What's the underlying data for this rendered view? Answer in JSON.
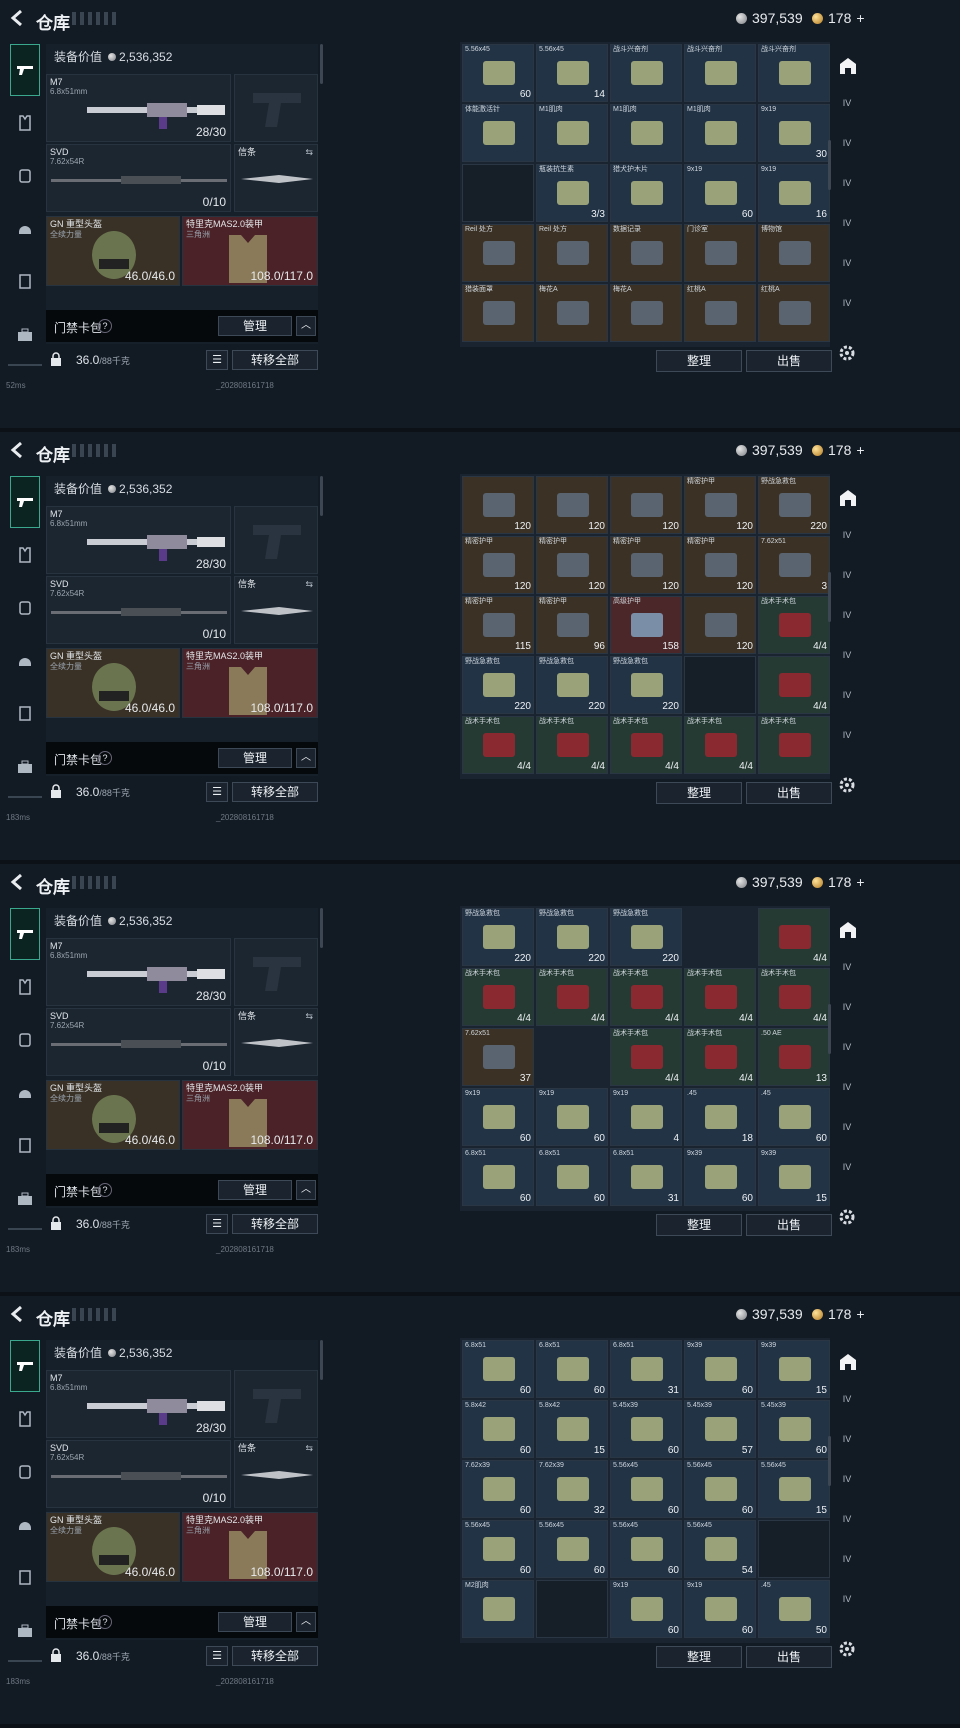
{
  "header": {
    "title": "仓库",
    "silver_amount": "397,539",
    "gold_amount": "178",
    "gold_plus": "+"
  },
  "loadout": {
    "equip_value_label": "装备价值",
    "equip_value": "2,536,352",
    "primary": {
      "name": "M7",
      "caliber": "6.8x51mm",
      "ammo": "28/30"
    },
    "secondary": {
      "name": "SVD",
      "caliber": "7.62x54R",
      "ammo": "0/10"
    },
    "melee": {
      "name": "信条"
    },
    "helmet": {
      "name": "GN 重型头盔",
      "sub": "全续力量",
      "durability": "46.0/46.0"
    },
    "armor": {
      "name": "特里克MAS2.0装甲",
      "sub": "三角洲",
      "durability": "108.0/117.0"
    },
    "keycard_label": "门禁卡包",
    "keycard_help": "?",
    "manage_label": "管理",
    "weight": "36.0",
    "weight_max": "/88千克",
    "transfer_all_label": "转移全部"
  },
  "stash_actions": {
    "sort_label": "整理",
    "sell_label": "出售"
  },
  "status": {
    "ping_1": "183ms",
    "ping_4": "52ms",
    "build": "_202808161718"
  },
  "panels": [
    {
      "cells": [
        {
          "c": 0,
          "r": 0,
          "t": "brown",
          "l": "",
          "n": "120"
        },
        {
          "c": 1,
          "r": 0,
          "t": "brown",
          "l": "",
          "n": "120"
        },
        {
          "c": 2,
          "r": 0,
          "t": "brown",
          "l": "",
          "n": "120"
        },
        {
          "c": 3,
          "r": 0,
          "t": "brown",
          "l": "精密护甲",
          "n": "120"
        },
        {
          "c": 4,
          "r": 0,
          "t": "brown",
          "l": "野战急救包",
          "n": "220"
        },
        {
          "c": 0,
          "r": 1,
          "t": "brown",
          "l": "精密护甲",
          "n": "120"
        },
        {
          "c": 1,
          "r": 1,
          "t": "brown",
          "l": "精密护甲",
          "n": "120"
        },
        {
          "c": 2,
          "r": 1,
          "t": "brown",
          "l": "精密护甲",
          "n": "120"
        },
        {
          "c": 3,
          "r": 1,
          "t": "brown",
          "l": "精密护甲",
          "n": "120"
        },
        {
          "c": 4,
          "r": 1,
          "t": "brown",
          "l": "7.62x51",
          "n": "3"
        },
        {
          "c": 0,
          "r": 2,
          "t": "brown",
          "l": "精密护甲",
          "n": "115"
        },
        {
          "c": 1,
          "r": 2,
          "t": "brown",
          "l": "精密护甲",
          "n": "96"
        },
        {
          "c": 2,
          "r": 2,
          "t": "red",
          "l": "高级护甲",
          "n": "158"
        },
        {
          "c": 3,
          "r": 2,
          "t": "brown",
          "l": "",
          "n": "120"
        },
        {
          "c": 4,
          "r": 2,
          "t": "green",
          "l": "战术手术包",
          "n": "4/4"
        },
        {
          "c": 0,
          "r": 3,
          "t": "blue",
          "l": "野战急救包",
          "n": "220"
        },
        {
          "c": 1,
          "r": 3,
          "t": "blue",
          "l": "野战急救包",
          "n": "220"
        },
        {
          "c": 2,
          "r": 3,
          "t": "blue",
          "l": "野战急救包",
          "n": "220"
        },
        {
          "c": 3,
          "r": 3,
          "t": "empty",
          "l": "",
          "n": ""
        },
        {
          "c": 4,
          "r": 3,
          "t": "green",
          "l": "",
          "n": "4/4"
        },
        {
          "c": 0,
          "r": 4,
          "t": "green",
          "l": "战术手术包",
          "n": "4/4"
        },
        {
          "c": 1,
          "r": 4,
          "t": "green",
          "l": "战术手术包",
          "n": "4/4"
        },
        {
          "c": 2,
          "r": 4,
          "t": "green",
          "l": "战术手术包",
          "n": "4/4"
        },
        {
          "c": 3,
          "r": 4,
          "t": "green",
          "l": "战术手术包",
          "n": "4/4"
        },
        {
          "c": 4,
          "r": 4,
          "t": "green",
          "l": "战术手术包",
          "n": ""
        }
      ]
    },
    {
      "cells": [
        {
          "c": 0,
          "r": 0,
          "t": "blue",
          "l": "野战急救包",
          "n": "220"
        },
        {
          "c": 1,
          "r": 0,
          "t": "blue",
          "l": "野战急救包",
          "n": "220"
        },
        {
          "c": 2,
          "r": 0,
          "t": "blue",
          "l": "野战急救包",
          "n": "220"
        },
        {
          "c": 4,
          "r": 0,
          "t": "green",
          "l": "",
          "n": "4/4"
        },
        {
          "c": 0,
          "r": 1,
          "t": "green",
          "l": "战术手术包",
          "n": "4/4"
        },
        {
          "c": 1,
          "r": 1,
          "t": "green",
          "l": "战术手术包",
          "n": "4/4"
        },
        {
          "c": 2,
          "r": 1,
          "t": "green",
          "l": "战术手术包",
          "n": "4/4"
        },
        {
          "c": 3,
          "r": 1,
          "t": "green",
          "l": "战术手术包",
          "n": "4/4"
        },
        {
          "c": 4,
          "r": 1,
          "t": "green",
          "l": "战术手术包",
          "n": "4/4"
        },
        {
          "c": 0,
          "r": 2,
          "t": "brown",
          "l": "7.62x51",
          "n": "37"
        },
        {
          "c": 2,
          "r": 2,
          "t": "green",
          "l": "战术手术包",
          "n": "4/4"
        },
        {
          "c": 3,
          "r": 2,
          "t": "green",
          "l": "战术手术包",
          "n": "4/4"
        },
        {
          "c": 4,
          "r": 2,
          "t": "green",
          "l": ".50 AE",
          "n": "13"
        },
        {
          "c": 0,
          "r": 3,
          "t": "blue",
          "l": "9x19",
          "n": "60"
        },
        {
          "c": 1,
          "r": 3,
          "t": "blue",
          "l": "9x19",
          "n": "60"
        },
        {
          "c": 2,
          "r": 3,
          "t": "blue",
          "l": "9x19",
          "n": "4"
        },
        {
          "c": 3,
          "r": 3,
          "t": "blue",
          "l": ".45",
          "n": "18"
        },
        {
          "c": 4,
          "r": 3,
          "t": "blue",
          "l": ".45",
          "n": "60"
        },
        {
          "c": 0,
          "r": 4,
          "t": "blue",
          "l": "6.8x51",
          "n": "60"
        },
        {
          "c": 1,
          "r": 4,
          "t": "blue",
          "l": "6.8x51",
          "n": "60"
        },
        {
          "c": 2,
          "r": 4,
          "t": "blue",
          "l": "6.8x51",
          "n": "31"
        },
        {
          "c": 3,
          "r": 4,
          "t": "blue",
          "l": "9x39",
          "n": "60"
        },
        {
          "c": 4,
          "r": 4,
          "t": "blue",
          "l": "9x39",
          "n": "15"
        }
      ]
    },
    {
      "cells": [
        {
          "c": 0,
          "r": 0,
          "t": "blue",
          "l": "6.8x51",
          "n": "60"
        },
        {
          "c": 1,
          "r": 0,
          "t": "blue",
          "l": "6.8x51",
          "n": "60"
        },
        {
          "c": 2,
          "r": 0,
          "t": "blue",
          "l": "6.8x51",
          "n": "31"
        },
        {
          "c": 3,
          "r": 0,
          "t": "blue",
          "l": "9x39",
          "n": "60"
        },
        {
          "c": 4,
          "r": 0,
          "t": "blue",
          "l": "9x39",
          "n": "15"
        },
        {
          "c": 0,
          "r": 1,
          "t": "blue",
          "l": "5.8x42",
          "n": "60"
        },
        {
          "c": 1,
          "r": 1,
          "t": "blue",
          "l": "5.8x42",
          "n": "15"
        },
        {
          "c": 2,
          "r": 1,
          "t": "blue",
          "l": "5.45x39",
          "n": "60"
        },
        {
          "c": 3,
          "r": 1,
          "t": "blue",
          "l": "5.45x39",
          "n": "57"
        },
        {
          "c": 4,
          "r": 1,
          "t": "blue",
          "l": "5.45x39",
          "n": "60"
        },
        {
          "c": 0,
          "r": 2,
          "t": "blue",
          "l": "7.62x39",
          "n": "60"
        },
        {
          "c": 1,
          "r": 2,
          "t": "blue",
          "l": "7.62x39",
          "n": "32"
        },
        {
          "c": 2,
          "r": 2,
          "t": "blue",
          "l": "5.56x45",
          "n": "60"
        },
        {
          "c": 3,
          "r": 2,
          "t": "blue",
          "l": "5.56x45",
          "n": "60"
        },
        {
          "c": 4,
          "r": 2,
          "t": "blue",
          "l": "5.56x45",
          "n": "15"
        },
        {
          "c": 0,
          "r": 3,
          "t": "blue",
          "l": "5.56x45",
          "n": "60"
        },
        {
          "c": 1,
          "r": 3,
          "t": "blue",
          "l": "5.56x45",
          "n": "60"
        },
        {
          "c": 2,
          "r": 3,
          "t": "blue",
          "l": "5.56x45",
          "n": "60"
        },
        {
          "c": 3,
          "r": 3,
          "t": "blue",
          "l": "5.56x45",
          "n": "54"
        },
        {
          "c": 4,
          "r": 3,
          "t": "empty",
          "l": "",
          "n": ""
        },
        {
          "c": 0,
          "r": 4,
          "t": "blue",
          "l": "M2肌肉",
          "n": ""
        },
        {
          "c": 1,
          "r": 4,
          "t": "empty",
          "l": "",
          "n": ""
        },
        {
          "c": 2,
          "r": 4,
          "t": "blue",
          "l": "9x19",
          "n": "60"
        },
        {
          "c": 3,
          "r": 4,
          "t": "blue",
          "l": "9x19",
          "n": "60"
        },
        {
          "c": 4,
          "r": 4,
          "t": "blue",
          "l": ".45",
          "n": "50"
        }
      ]
    },
    {
      "cells": [
        {
          "c": 0,
          "r": 0,
          "t": "blue",
          "l": "5.56x45",
          "n": "60"
        },
        {
          "c": 1,
          "r": 0,
          "t": "blue",
          "l": "5.56x45",
          "n": "14"
        },
        {
          "c": 2,
          "r": 0,
          "t": "blue",
          "l": "战斗兴奋剂",
          "n": ""
        },
        {
          "c": 3,
          "r": 0,
          "t": "blue",
          "l": "战斗兴奋剂",
          "n": ""
        },
        {
          "c": 4,
          "r": 0,
          "t": "blue",
          "l": "战斗兴奋剂",
          "n": ""
        },
        {
          "c": 0,
          "r": 1,
          "t": "blue",
          "l": "体能激活针",
          "n": ""
        },
        {
          "c": 1,
          "r": 1,
          "t": "blue",
          "l": "M1肌肉",
          "n": ""
        },
        {
          "c": 2,
          "r": 1,
          "t": "blue",
          "l": "M1肌肉",
          "n": ""
        },
        {
          "c": 3,
          "r": 1,
          "t": "blue",
          "l": "M1肌肉",
          "n": ""
        },
        {
          "c": 4,
          "r": 1,
          "t": "blue",
          "l": "9x19",
          "n": "30"
        },
        {
          "c": 0,
          "r": 2,
          "t": "empty",
          "l": "",
          "n": ""
        },
        {
          "c": 1,
          "r": 2,
          "t": "blue",
          "l": "瓶装抗生素",
          "n": "3/3"
        },
        {
          "c": 2,
          "r": 2,
          "t": "blue",
          "l": "猎犬护木片",
          "n": ""
        },
        {
          "c": 3,
          "r": 2,
          "t": "blue",
          "l": "9x19",
          "n": "60"
        },
        {
          "c": 4,
          "r": 2,
          "t": "blue",
          "l": "9x19",
          "n": "16"
        },
        {
          "c": 0,
          "r": 3,
          "t": "brown",
          "l": "Reil 处方",
          "n": ""
        },
        {
          "c": 1,
          "r": 3,
          "t": "brown",
          "l": "Reil 处方",
          "n": ""
        },
        {
          "c": 2,
          "r": 3,
          "t": "brown",
          "l": "数据记录",
          "n": ""
        },
        {
          "c": 3,
          "r": 3,
          "t": "brown",
          "l": "门诊室",
          "n": ""
        },
        {
          "c": 4,
          "r": 3,
          "t": "brown",
          "l": "博物馆",
          "n": ""
        },
        {
          "c": 0,
          "r": 4,
          "t": "brown",
          "l": "猎装面罩",
          "n": ""
        },
        {
          "c": 1,
          "r": 4,
          "t": "brown",
          "l": "梅花A",
          "n": ""
        },
        {
          "c": 2,
          "r": 4,
          "t": "brown",
          "l": "梅花A",
          "n": ""
        },
        {
          "c": 3,
          "r": 4,
          "t": "brown",
          "l": "红桃A",
          "n": ""
        },
        {
          "c": 4,
          "r": 4,
          "t": "brown",
          "l": "红桃A",
          "n": ""
        }
      ]
    }
  ]
}
